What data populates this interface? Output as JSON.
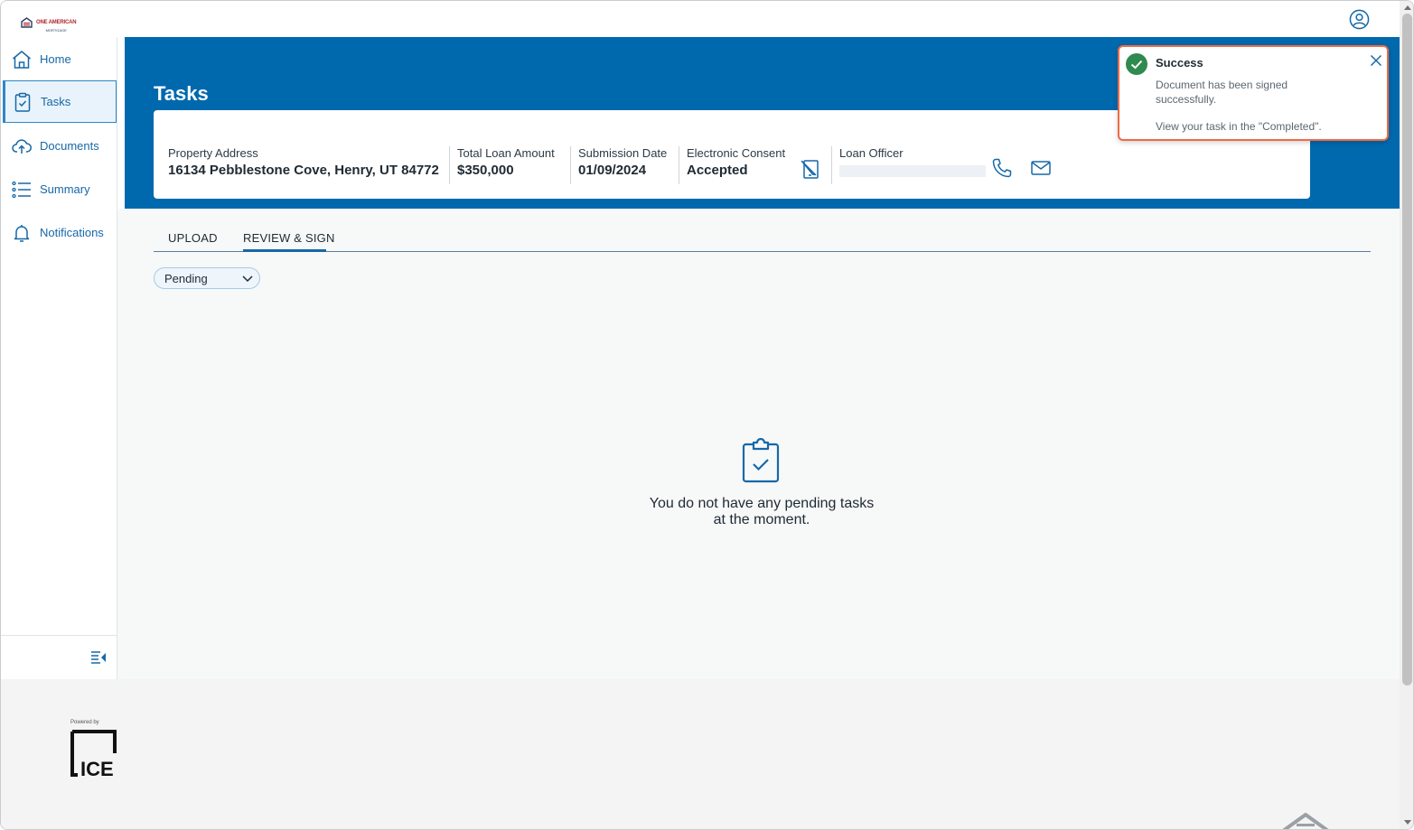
{
  "brand": {
    "name": "ONE AMERICAN",
    "sub": "MORTGAGE"
  },
  "sidebar": {
    "items": [
      {
        "label": "Home",
        "icon": "home-icon"
      },
      {
        "label": "Tasks",
        "icon": "clipboard-check-icon",
        "active": true
      },
      {
        "label": "Documents",
        "icon": "cloud-upload-icon"
      },
      {
        "label": "Summary",
        "icon": "list-icon"
      },
      {
        "label": "Notifications",
        "icon": "bell-icon"
      }
    ]
  },
  "page": {
    "title": "Tasks"
  },
  "loan": {
    "property_address_label": "Property Address",
    "property_address": "16134 Pebblestone Cove, Henry, UT 84772",
    "loan_amount_label": "Total Loan Amount",
    "loan_amount": "$350,000",
    "submission_date_label": "Submission Date",
    "submission_date": "01/09/2024",
    "consent_label": "Electronic Consent",
    "consent_value": "Accepted",
    "officer_label": "Loan Officer"
  },
  "tabs": [
    {
      "label": "UPLOAD"
    },
    {
      "label": "REVIEW & SIGN",
      "active": true
    }
  ],
  "filter": {
    "selected": "Pending"
  },
  "empty_state": {
    "line1": "You do not have any pending tasks",
    "line2": "at the moment."
  },
  "footer": {
    "powered_by": "Powered by",
    "logo_text": "ICE"
  },
  "toast": {
    "title": "Success",
    "message": "Document has been signed successfully.",
    "link": "View your task in the \"Completed\"."
  },
  "colors": {
    "brand_blue": "#0069ad",
    "accent": "#1668a8",
    "success": "#2e8a4f",
    "toast_border": "#ee6a45"
  }
}
